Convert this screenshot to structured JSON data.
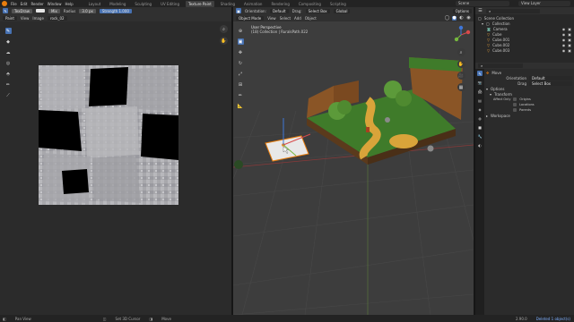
{
  "topbar": {
    "menus": [
      "File",
      "Edit",
      "Render",
      "Window",
      "Help"
    ],
    "workspaces": [
      "Layout",
      "Modeling",
      "Sculpting",
      "UV Editing",
      "Texture Paint",
      "Shading",
      "Animation",
      "Rendering",
      "Compositing",
      "Scripting"
    ],
    "active_workspace": "Texture Paint",
    "scene": "Scene",
    "view_layer": "View Layer"
  },
  "image_editor": {
    "tool_label": "TexDraw",
    "blend": "Mix",
    "radius_label": "Radius",
    "radius_value": "3.0 px",
    "strength_label": "Strength",
    "strength_value": "1.000",
    "mode": "Paint",
    "menus": [
      "View",
      "Image"
    ],
    "image_name": "rock_02",
    "icons": [
      "paintbrush-icon",
      "fill-icon",
      "smear-icon",
      "clone-icon",
      "mask-icon",
      "annotate-icon",
      "sample-icon"
    ]
  },
  "viewport": {
    "mode": "Object Mode",
    "menus": [
      "View",
      "Select",
      "Add",
      "Object"
    ],
    "orientation": "Orientation:",
    "orientation_value": "Default",
    "drag": "Drag:",
    "drag_value": "Select Box",
    "transform": "Global",
    "options": "Options",
    "overlay_title": "User Perspective",
    "overlay_sub": "(18) Collection | RuralsPath.022"
  },
  "outliner": {
    "root": "Scene Collection",
    "collection": "Collection",
    "items": [
      {
        "name": "Camera",
        "icon": "camera-icon",
        "color": "#6fb1a0"
      },
      {
        "name": "Cube",
        "icon": "mesh-icon",
        "color": "#e8a33d"
      },
      {
        "name": "Cube.001",
        "icon": "mesh-icon",
        "color": "#e8a33d"
      },
      {
        "name": "Cube.002",
        "icon": "mesh-icon",
        "color": "#e8a33d"
      },
      {
        "name": "Cube.003",
        "icon": "mesh-icon",
        "color": "#e8a33d"
      }
    ]
  },
  "properties": {
    "panel_title": "Move",
    "orientation_label": "Orientation",
    "orientation_value": "Default",
    "drag_label": "Drag",
    "drag_value": "Select Box",
    "options_label": "Options",
    "transform_label": "Transform",
    "affect_only_label": "Affect Only",
    "checkboxes": [
      "Origins",
      "Locations",
      "Parents"
    ],
    "workspace_label": "Workspace"
  },
  "statusbar": {
    "items": [
      "Pan View",
      "Set 3D Cursor",
      "Move"
    ],
    "version": "2.90.0",
    "selection": "Deleted 1 object(s)"
  },
  "colors": {
    "accent": "#4772b3",
    "blender_orange": "#e87d0d",
    "grass": "#3f7b2a",
    "path": "#d9a43a",
    "wood": "#8a5526"
  }
}
